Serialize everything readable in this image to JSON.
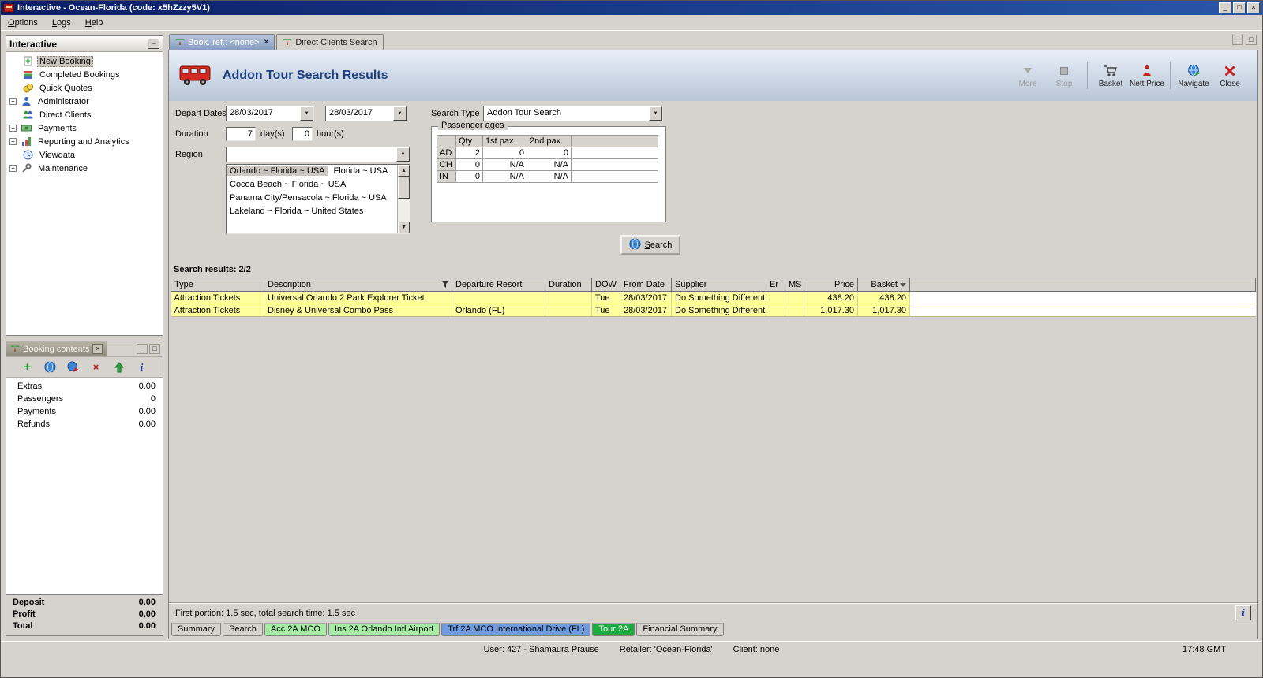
{
  "window": {
    "title": "Interactive - Ocean-Florida (code: x5hZzzy5V1)"
  },
  "menu": {
    "items": [
      "Options",
      "Logs",
      "Help"
    ]
  },
  "icons": {
    "minimize": "_",
    "maximize": "□",
    "close": "×",
    "dropdown": "▼",
    "scroll_up": "▲",
    "scroll_down": "▼",
    "expand": "+",
    "collapse_panel": "−",
    "restore": "□",
    "add": "+",
    "delete": "×",
    "info": "i",
    "tab_close": "×"
  },
  "colors": {
    "panel_bg": "#d6d3ce",
    "titlebar_a": "#0a1e66",
    "titlebar_b": "#2a56a8",
    "row_highlight": "#ffff9e",
    "tab_green": "#a6eca6",
    "tab_blue": "#6f9be0",
    "tab_active_green": "#1cab40",
    "title_text": "#1e3f7d",
    "hdr_grad_a": "#e7eef8",
    "hdr_grad_b": "#b9c6d6"
  },
  "sidebar": {
    "title": "Interactive",
    "items": [
      {
        "label": "New Booking"
      },
      {
        "label": "Completed Bookings"
      },
      {
        "label": "Quick Quotes"
      },
      {
        "label": "Administrator"
      },
      {
        "label": "Direct Clients"
      },
      {
        "label": "Payments"
      },
      {
        "label": "Reporting and Analytics"
      },
      {
        "label": "Viewdata"
      },
      {
        "label": "Maintenance"
      }
    ]
  },
  "booking_contents": {
    "title": "Booking contents",
    "rows": [
      {
        "label": "Extras",
        "value": "0.00"
      },
      {
        "label": "Passengers",
        "value": "0"
      },
      {
        "label": "Payments",
        "value": "0.00"
      },
      {
        "label": "Refunds",
        "value": "0.00"
      }
    ],
    "totals": [
      {
        "label": "Deposit",
        "value": "0.00"
      },
      {
        "label": "Profit",
        "value": "0.00"
      },
      {
        "label": "Total",
        "value": "0.00"
      }
    ]
  },
  "main_tabs": [
    {
      "label": "Book. ref.: <none>"
    },
    {
      "label": "Direct Clients Search"
    }
  ],
  "header": {
    "title": "Addon Tour Search Results",
    "tools": [
      {
        "label": "More"
      },
      {
        "label": "Stop"
      },
      {
        "label": "Basket"
      },
      {
        "label": "Nett Price"
      },
      {
        "label": "Navigate"
      },
      {
        "label": "Close"
      }
    ]
  },
  "form": {
    "depart_dates_label": "Depart Dates",
    "date_from": "28/03/2017",
    "date_to": "28/03/2017",
    "search_type_label": "Search Type",
    "search_type_value": "Addon Tour Search",
    "duration_label": "Duration",
    "duration_days": "7",
    "days_suffix": "day(s)",
    "duration_hours": "0",
    "hours_suffix": "hour(s)",
    "region_label": "Region",
    "region_value": "",
    "region_list": [
      "Orlando ~ Florida ~ USA",
      "Florida ~ USA",
      "Cocoa Beach ~ Florida ~ USA",
      "Panama City/Pensacola ~ Florida ~ USA",
      "Lakeland ~ Florida ~ United States"
    ],
    "passenger_ages": {
      "title": "Passenger ages",
      "col_qty": "Qty",
      "col_pax1": "1st pax",
      "col_pax2": "2nd pax",
      "rows": [
        {
          "type": "AD",
          "qty": "2",
          "pax1": "0",
          "pax2": "0"
        },
        {
          "type": "CH",
          "qty": "0",
          "pax1": "N/A",
          "pax2": "N/A"
        },
        {
          "type": "IN",
          "qty": "0",
          "pax1": "N/A",
          "pax2": "N/A"
        }
      ]
    },
    "search_button": "Search"
  },
  "results": {
    "summary": "Search results: 2/2",
    "columns": [
      "Type",
      "Description",
      "Departure Resort",
      "Duration",
      "DOW",
      "From Date",
      "Supplier",
      "Er",
      "MS",
      "Price",
      "Basket"
    ],
    "rows": [
      [
        "Attraction Tickets",
        "Universal Orlando 2 Park Explorer Ticket",
        "",
        "",
        "Tue",
        "28/03/2017",
        "Do Something Different",
        "",
        "",
        "438.20",
        "438.20"
      ],
      [
        "Attraction Tickets",
        "Disney & Universal Combo Pass",
        "Orlando (FL)",
        "",
        "Tue",
        "28/03/2017",
        "Do Something Different",
        "",
        "",
        "1,017.30",
        "1,017.30"
      ]
    ],
    "status": "First portion: 1.5 sec, total search time: 1.5 sec",
    "info_button": "i"
  },
  "bottom_tabs": [
    {
      "label": "Summary"
    },
    {
      "label": "Search"
    },
    {
      "label": "Acc 2A MCO"
    },
    {
      "label": "Ins 2A Orlando Intl Airport"
    },
    {
      "label": "Trf 2A MCO International Drive (FL)"
    },
    {
      "label": "Tour 2A"
    },
    {
      "label": "Financial Summary"
    }
  ],
  "status_bar": {
    "user": "User: 427 - Shamaura Prause",
    "retailer": "Retailer: 'Ocean-Florida'",
    "client": "Client: none",
    "time": "17:48 GMT"
  }
}
